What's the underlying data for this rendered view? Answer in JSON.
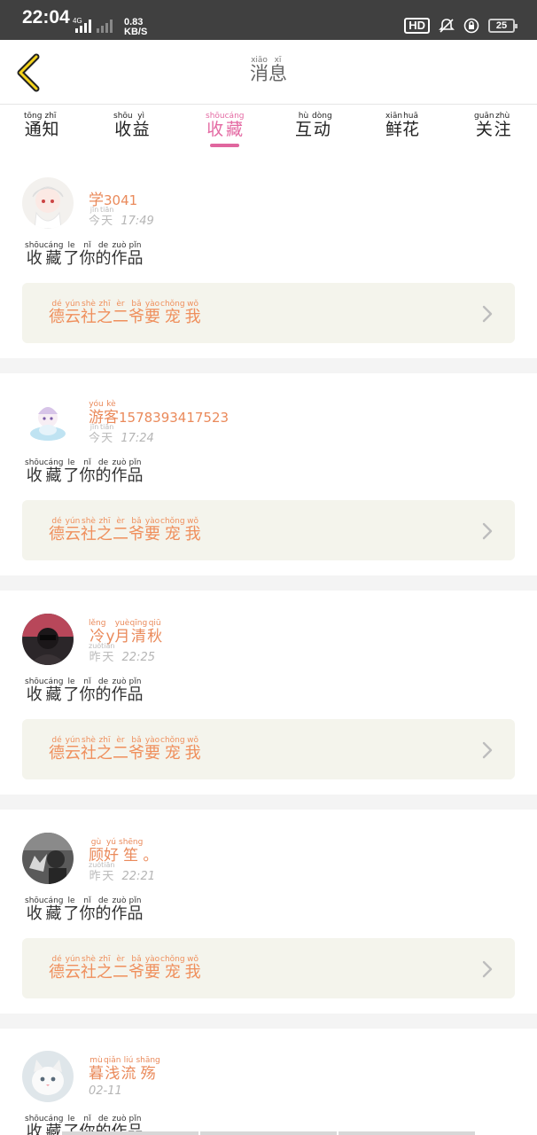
{
  "status_bar": {
    "time": "22:04",
    "network": "4G",
    "speed_value": "0.83",
    "speed_unit": "KB/S",
    "hd_label": "HD",
    "battery": "25"
  },
  "nav": {
    "title": [
      {
        "py": "xiāo",
        "hz": "消"
      },
      {
        "py": "xī",
        "hz": "息"
      }
    ]
  },
  "tabs": [
    {
      "key": "notify",
      "chars": [
        {
          "py": "tōng",
          "hz": "通"
        },
        {
          "py": "zhī",
          "hz": "知"
        }
      ],
      "active": false
    },
    {
      "key": "earnings",
      "chars": [
        {
          "py": "shōu",
          "hz": "收"
        },
        {
          "py": "yì",
          "hz": "益"
        }
      ],
      "active": false
    },
    {
      "key": "favorite",
      "chars": [
        {
          "py": "shōu",
          "hz": "收"
        },
        {
          "py": "cáng",
          "hz": "藏"
        }
      ],
      "active": true
    },
    {
      "key": "interact",
      "chars": [
        {
          "py": "hù",
          "hz": "互"
        },
        {
          "py": "dòng",
          "hz": "动"
        }
      ],
      "active": false
    },
    {
      "key": "flowers",
      "chars": [
        {
          "py": "xiān",
          "hz": "鲜"
        },
        {
          "py": "huā",
          "hz": "花"
        }
      ],
      "active": false
    },
    {
      "key": "follow",
      "chars": [
        {
          "py": "guān",
          "hz": "关"
        },
        {
          "py": "zhù",
          "hz": "注"
        }
      ],
      "active": false
    }
  ],
  "action_text": [
    {
      "py": "shōu",
      "hz": "收"
    },
    {
      "py": "cáng",
      "hz": "藏"
    },
    {
      "py": "le",
      "hz": "了"
    },
    {
      "py": "nǐ",
      "hz": "你"
    },
    {
      "py": "de",
      "hz": "的"
    },
    {
      "py": "zuò",
      "hz": "作"
    },
    {
      "py": "pǐn",
      "hz": "品"
    }
  ],
  "work_title": [
    {
      "py": "dé",
      "hz": "德"
    },
    {
      "py": "yún",
      "hz": "云"
    },
    {
      "py": "shè",
      "hz": "社"
    },
    {
      "py": "zhī",
      "hz": "之"
    },
    {
      "py": "èr",
      "hz": "二"
    },
    {
      "py": "bǎ",
      "hz": "爷"
    },
    {
      "py": "yào",
      "hz": "要"
    },
    {
      "py": "chǒng",
      "hz": "宠"
    },
    {
      "py": "wǒ",
      "hz": "我"
    }
  ],
  "messages": [
    {
      "user": {
        "chars": [
          {
            "py": "",
            "hz": "学"
          }
        ],
        "suffix": "3041"
      },
      "day": [
        {
          "py": "jīn",
          "hz": "今"
        },
        {
          "py": "tiān",
          "hz": "天"
        }
      ],
      "time": "17:49"
    },
    {
      "user": {
        "chars": [
          {
            "py": "yóu",
            "hz": "游"
          },
          {
            "py": "kè",
            "hz": "客"
          }
        ],
        "suffix": "1578393417523"
      },
      "day": [
        {
          "py": "jīn",
          "hz": "今"
        },
        {
          "py": "tiān",
          "hz": "天"
        }
      ],
      "time": "17:24"
    },
    {
      "user": {
        "chars": [
          {
            "py": "lěng",
            "hz": "冷"
          },
          {
            "py": "",
            "hz": "y"
          },
          {
            "py": "yuè",
            "hz": "月"
          },
          {
            "py": "qīng",
            "hz": "清"
          },
          {
            "py": "qiū",
            "hz": "秋"
          }
        ],
        "suffix": ""
      },
      "day": [
        {
          "py": "zuó",
          "hz": "昨"
        },
        {
          "py": "tiān",
          "hz": "天"
        }
      ],
      "time": "22:25"
    },
    {
      "user": {
        "chars": [
          {
            "py": "gù",
            "hz": "顾"
          },
          {
            "py": "yú",
            "hz": "好"
          },
          {
            "py": "shēng",
            "hz": "笙"
          },
          {
            "py": "",
            "hz": "。"
          }
        ],
        "suffix": ""
      },
      "day": [
        {
          "py": "zuó",
          "hz": "昨"
        },
        {
          "py": "tiān",
          "hz": "天"
        }
      ],
      "time": "22:21"
    },
    {
      "user": {
        "chars": [
          {
            "py": "mù",
            "hz": "暮"
          },
          {
            "py": "qiǎn",
            "hz": "浅"
          },
          {
            "py": "liú",
            "hz": "流"
          },
          {
            "py": "shāng",
            "hz": "殇"
          }
        ],
        "suffix": ""
      },
      "day": [],
      "time": "02-11"
    }
  ]
}
